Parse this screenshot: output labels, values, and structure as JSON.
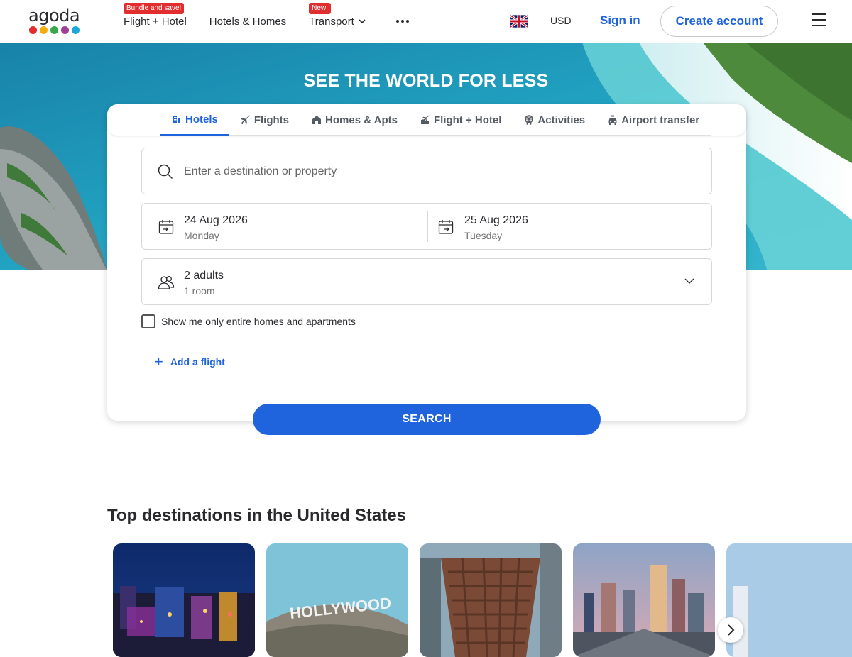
{
  "header": {
    "logo_text": "agoda",
    "logo_dot_colors": [
      "#e12d2d",
      "#f6ad10",
      "#3aa64b",
      "#9e4196",
      "#1ea7d6"
    ],
    "nav": [
      {
        "label": "Flight + Hotel",
        "badge": "Bundle and save!"
      },
      {
        "label": "Hotels & Homes",
        "badge": ""
      },
      {
        "label": "Transport",
        "badge": "New!"
      }
    ],
    "more_icon": "more-dots-icon",
    "currency": "USD",
    "signin": "Sign in",
    "create_account": "Create account",
    "flag_icon": "uk-flag-icon"
  },
  "hero": {
    "title": "SEE THE WORLD FOR LESS"
  },
  "tabs": [
    {
      "label": "Hotels",
      "icon": "hotel-icon",
      "active": true
    },
    {
      "label": "Flights",
      "icon": "plane-icon",
      "active": false
    },
    {
      "label": "Homes & Apts",
      "icon": "home-icon",
      "active": false
    },
    {
      "label": "Flight + Hotel",
      "icon": "flight-hotel-icon",
      "active": false
    },
    {
      "label": "Activities",
      "icon": "activities-icon",
      "active": false
    },
    {
      "label": "Airport transfer",
      "icon": "car-icon",
      "active": false
    }
  ],
  "search": {
    "destination_placeholder": "Enter a destination or property",
    "checkin_date": "24 Aug 2026",
    "checkin_day": "Monday",
    "checkout_date": "25 Aug 2026",
    "checkout_day": "Tuesday",
    "guests": "2 adults",
    "rooms": "1 room",
    "entire_homes_label": "Show me only entire homes and apartments",
    "add_flight": "Add a flight",
    "search_button": "SEARCH"
  },
  "destinations": {
    "title": "Top destinations in the United States"
  },
  "colors": {
    "accent": "#1f64dc",
    "badge": "#e12d2d"
  }
}
